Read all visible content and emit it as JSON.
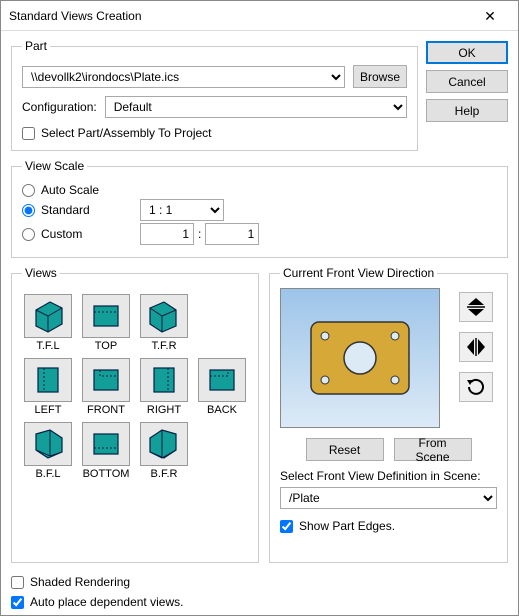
{
  "window": {
    "title": "Standard Views Creation"
  },
  "buttons": {
    "ok": "OK",
    "cancel": "Cancel",
    "help": "Help",
    "browse": "Browse",
    "reset": "Reset",
    "from_scene": "From Scene"
  },
  "part": {
    "legend": "Part",
    "path": "\\\\devollk2\\irondocs\\Plate.ics",
    "config_label": "Configuration:",
    "config_value": "Default",
    "select_to_project": "Select Part/Assembly To Project",
    "select_to_project_checked": false
  },
  "scale": {
    "legend": "View Scale",
    "auto": "Auto Scale",
    "standard": "Standard",
    "custom": "Custom",
    "selected": "standard",
    "standard_ratio": "1 : 1",
    "custom_left": "1",
    "custom_sep": ":",
    "custom_right": "1"
  },
  "views": {
    "legend": "Views",
    "items": [
      {
        "id": "tfl",
        "label": "T.F.L"
      },
      {
        "id": "top",
        "label": "TOP"
      },
      {
        "id": "tfr",
        "label": "T.F.R"
      },
      {
        "id": "left",
        "label": "LEFT"
      },
      {
        "id": "front",
        "label": "FRONT"
      },
      {
        "id": "right",
        "label": "RIGHT"
      },
      {
        "id": "back",
        "label": "BACK"
      },
      {
        "id": "bfl",
        "label": "B.F.L"
      },
      {
        "id": "bottom",
        "label": "BOTTOM"
      },
      {
        "id": "bfr",
        "label": "B.F.R"
      }
    ]
  },
  "front": {
    "legend": "Current Front View Direction",
    "select_label": "Select Front View Definition in Scene:",
    "definition": "/Plate",
    "show_edges_label": "Show Part Edges.",
    "show_edges_checked": true
  },
  "options": {
    "shaded": "Shaded Rendering",
    "shaded_checked": false,
    "auto_place": "Auto place dependent views.",
    "auto_place_checked": true
  }
}
